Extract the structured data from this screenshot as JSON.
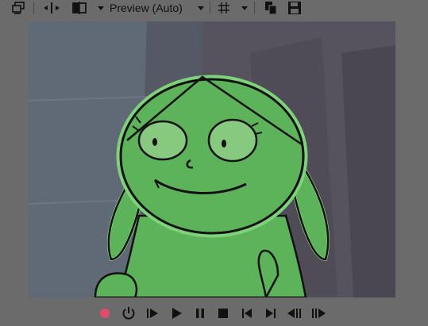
{
  "toolbar": {
    "preview_select": {
      "value": "Preview (Auto)"
    },
    "icons": [
      "window-icon",
      "split-icon",
      "compare-icon",
      "grid-icon",
      "copy-icon",
      "save-icon"
    ]
  },
  "viewer": {
    "description_colors": {
      "background": "#56525e",
      "wall": "#5f6a76",
      "character_fill": "#5cb35a",
      "character_outline": "#111111",
      "eye_fill": "#86c97f",
      "highlight_outline": "#7fd27a"
    }
  },
  "transport": {
    "buttons": [
      "record",
      "power-loop",
      "play-from-start",
      "play",
      "pause",
      "stop",
      "previous-frame",
      "next-frame",
      "step-back",
      "step-forward"
    ],
    "record_color": "#e24b6b"
  }
}
